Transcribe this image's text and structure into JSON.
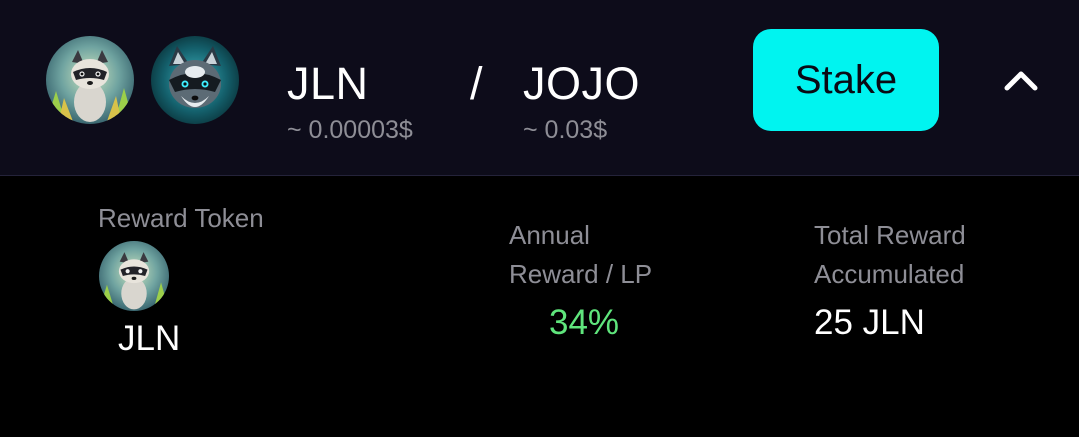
{
  "pair": {
    "token_a": {
      "symbol": "JLN",
      "price": "~ 0.00003$",
      "icon": "raccoon-jln-icon"
    },
    "separator": "/",
    "token_b": {
      "symbol": "JOJO",
      "price": "~ 0.03$",
      "icon": "raccoon-jojo-icon"
    }
  },
  "actions": {
    "stake_label": "Stake",
    "collapse_icon": "chevron-up-icon"
  },
  "details": {
    "reward_token_label": "Reward Token",
    "reward_token_symbol": "JLN",
    "annual_label_line1": "Annual",
    "annual_label_line2": "Reward / LP",
    "annual_value": "34%",
    "total_label_line1": "Total Reward",
    "total_label_line2": "Accumulated",
    "total_value": "25 JLN"
  },
  "colors": {
    "header_bg": "#0d0c1a",
    "body_bg": "#000000",
    "stake_button": "#00f4f0",
    "apr_green": "#5fe57c",
    "muted_text": "#8e8e96"
  }
}
